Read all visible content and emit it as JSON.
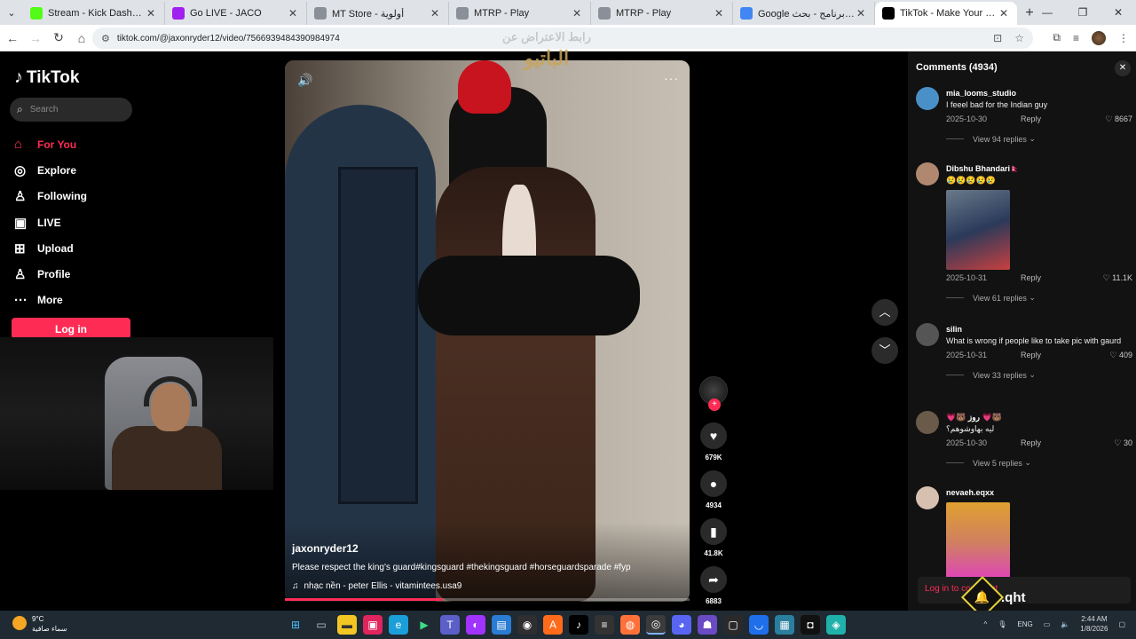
{
  "browser": {
    "tabs": [
      {
        "title": "Stream - Kick Dashboard",
        "color": "#53fc18"
      },
      {
        "title": "Go LIVE - JACO",
        "color": "#a020f0"
      },
      {
        "title": "MT Store - أولوية",
        "color": "#8a8f98"
      },
      {
        "title": "MTRP - Play",
        "color": "#8a8f98"
      },
      {
        "title": "MTRP - Play",
        "color": "#8a8f98"
      },
      {
        "title": "Google كاريزما برنامج - بحث",
        "color": "#4285f4"
      },
      {
        "title": "TikTok - Make Your Day",
        "color": "#000000",
        "active": true
      }
    ],
    "url": "tiktok.com/@jaxonryder12/video/7566939484390984974"
  },
  "tiktok": {
    "logo": "TikTok",
    "search_placeholder": "Search",
    "nav": [
      {
        "label": "For You",
        "icon": "home-icon",
        "glyph": "⌂",
        "active": true
      },
      {
        "label": "Explore",
        "icon": "compass-icon",
        "glyph": "◎"
      },
      {
        "label": "Following",
        "icon": "user-icon",
        "glyph": "♙"
      },
      {
        "label": "LIVE",
        "icon": "live-icon",
        "glyph": "▣"
      },
      {
        "label": "Upload",
        "icon": "upload-icon",
        "glyph": "⊞"
      },
      {
        "label": "Profile",
        "icon": "profile-icon",
        "glyph": "♙"
      },
      {
        "label": "More",
        "icon": "more-icon",
        "glyph": "···"
      }
    ],
    "login_label": "Log in",
    "accent": "#fe2c55"
  },
  "video": {
    "author": "jaxonryder12",
    "caption": "Please respect the king's guard#kingsguard #thekingsguard #horseguardsparade #fyp",
    "music": "nhạc nền - peter Ellis - vitamintees.usa9",
    "progress": 0.39,
    "watermark_top": "رابط الاعتراض عن",
    "watermark_main": "الباتيو",
    "likes": "679K",
    "comments": "4934",
    "saves": "41.8K",
    "shares": "6883"
  },
  "comments_panel": {
    "header": "Comments (4934)",
    "items": [
      {
        "user": "mia_looms_studio",
        "text": "I feeel bad for the Indian guy",
        "date": "2025-10-30",
        "reply": "Reply",
        "likes": "8667",
        "replies": "View 94 replies",
        "avatar_color": "#4a90c8"
      },
      {
        "user": "Dibshu Bhandari🇳🇵",
        "text": "😢😢😢😢😢",
        "date": "2025-10-31",
        "reply": "Reply",
        "likes": "11.1K",
        "replies": "View 61 replies",
        "avatar_color": "#b08870"
      },
      {
        "user": "silin",
        "text": "What is wrong if people like to take pic with gaurd",
        "date": "2025-10-31",
        "reply": "Reply",
        "likes": "409",
        "replies": "View 33 replies",
        "avatar_color": "#555555"
      },
      {
        "user": "💗🐻 روز 💗🐻",
        "text": "ليه بهاوشوهم؟",
        "date": "2025-10-30",
        "reply": "Reply",
        "likes": "30",
        "replies": "View 5 replies",
        "avatar_color": "#6a5a4a"
      },
      {
        "user": "nevaeh.eqxx",
        "avatar_color": "#d8c0b0"
      }
    ],
    "login_prompt": "Log in to comment"
  },
  "overlay": {
    "brand": ".qht"
  },
  "taskbar": {
    "temp": "9°C",
    "weather": "سماء صافية",
    "lang": "ENG",
    "time": "2:44 AM",
    "date": "1/8/2026"
  }
}
